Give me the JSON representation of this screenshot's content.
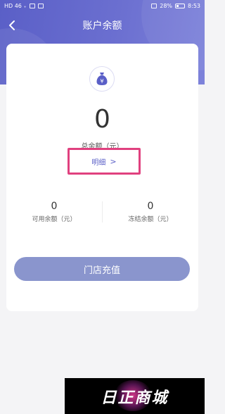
{
  "status_bar": {
    "left": "HD 46 ₊",
    "right": "28%",
    "time": "8:53"
  },
  "nav": {
    "title": "账户余额",
    "back_icon": "chevron-left-icon"
  },
  "balance": {
    "icon": "money-bag-icon",
    "icon_symbol": "¥",
    "total_value": "0",
    "total_label": "总余额（元）",
    "detail_label": "明细",
    "detail_chevron": ">"
  },
  "available": {
    "value": "0",
    "label": "可用余额（元）"
  },
  "frozen": {
    "value": "0",
    "label": "冻结余额（元）"
  },
  "actions": {
    "recharge_label": "门店充值"
  },
  "watermark": {
    "text": "日正商城"
  },
  "colors": {
    "accent": "#5a5fc7",
    "button": "#8a95cd",
    "highlight": "#e0417f"
  }
}
